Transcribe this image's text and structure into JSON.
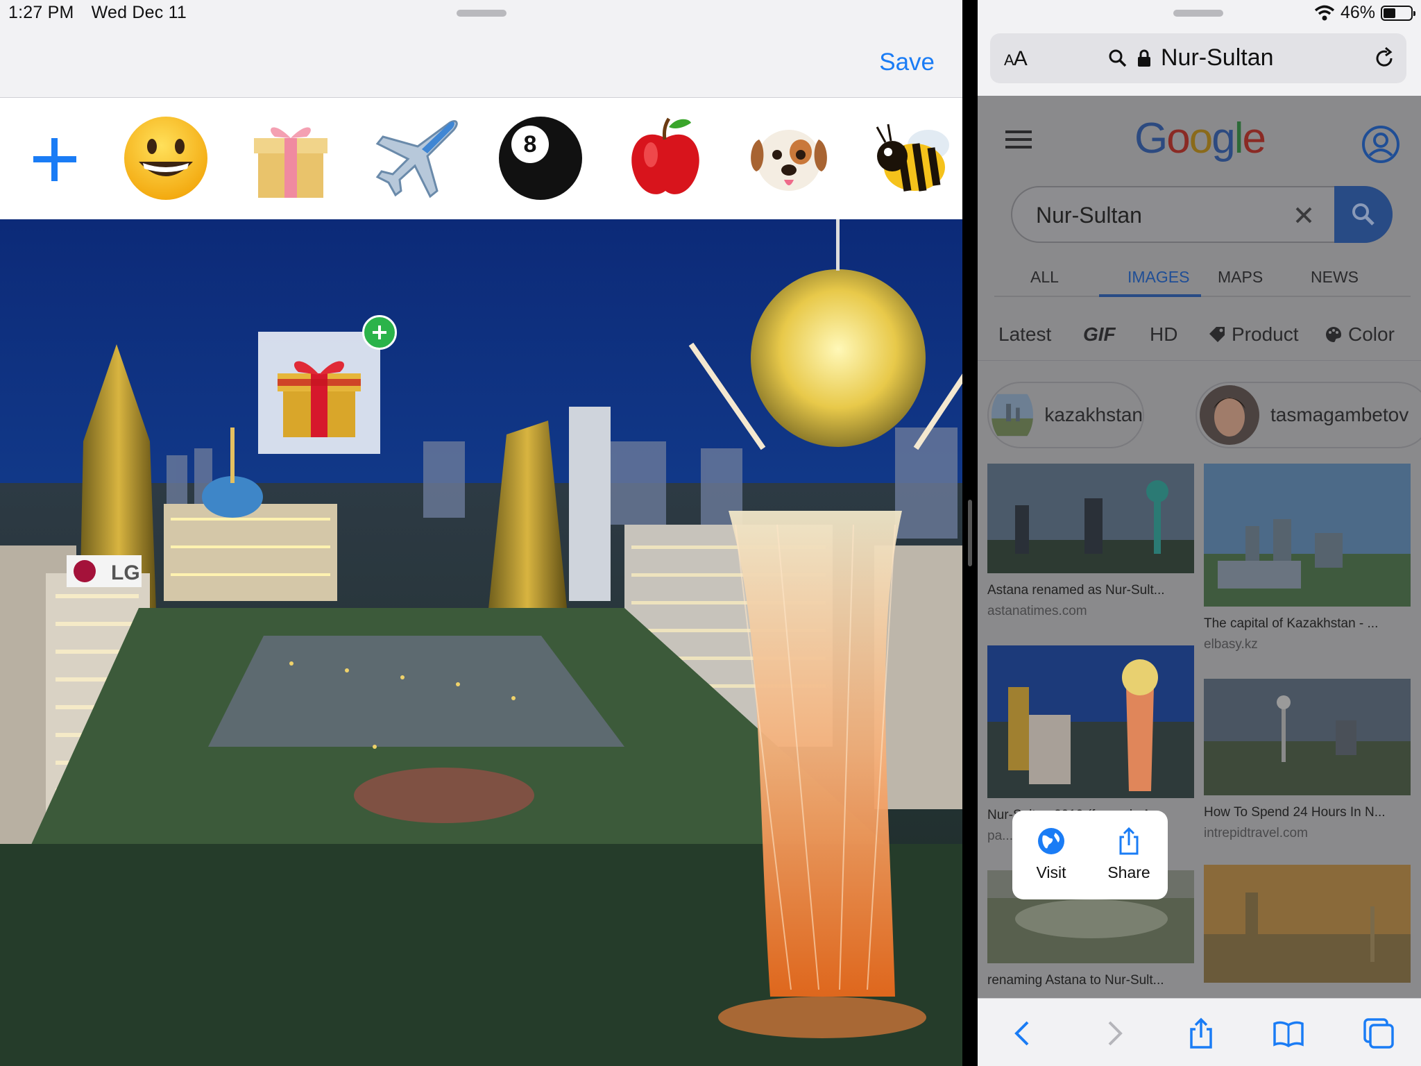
{
  "status_bar": {
    "time": "1:27 PM",
    "date": "Wed Dec 11",
    "battery_percent": "46%",
    "battery_level": 0.46
  },
  "left_app": {
    "save_label": "Save",
    "sticker_tray": {
      "add_icon": "plus-icon",
      "stickers": [
        "grinning-face-sticker",
        "gift-sticker",
        "airplane-sticker",
        "eight-ball-sticker",
        "red-apple-sticker",
        "dog-face-sticker",
        "honeybee-sticker"
      ]
    },
    "canvas": {
      "photo": "nur-sultan-skyline-photo",
      "placed_sticker": "gift-sticker",
      "placed_badge_icon": "plus-circle-icon"
    },
    "photo_signage": {
      "lg_sign": "LG"
    }
  },
  "safari": {
    "reader_label": "AA",
    "address": "Nur-Sultan",
    "google": {
      "logo": "Google",
      "search_value": "Nur-Sultan",
      "tabs": [
        "ALL",
        "IMAGES",
        "MAPS",
        "NEWS"
      ],
      "active_tab": "IMAGES",
      "filters": [
        "Latest",
        "GIF",
        "HD",
        "Product",
        "Color"
      ],
      "chips": [
        {
          "label": "kazakhstan"
        },
        {
          "label": "tasmagambetov"
        }
      ],
      "results_left": [
        {
          "caption": "Astana renamed as Nur-Sult...",
          "source": "astanatimes.com"
        },
        {
          "caption": "Nur-Sultan 2019 (formerly A...",
          "source": "pa..."
        },
        {
          "caption": "renaming Astana to Nur-Sult...",
          "source": ""
        }
      ],
      "results_right": [
        {
          "caption": "The capital of Kazakhstan - ...",
          "source": "elbasy.kz"
        },
        {
          "caption": "How To Spend 24 Hours In N...",
          "source": "intrepidtravel.com"
        },
        {
          "caption": "",
          "source": ""
        }
      ]
    },
    "context_menu": {
      "visit_label": "Visit",
      "share_label": "Share"
    },
    "toolbar": [
      "back-icon",
      "forward-icon",
      "share-icon",
      "bookmarks-icon",
      "tabs-icon"
    ]
  },
  "colors": {
    "accent_blue": "#1a7cf5",
    "badge_green": "#2bb34a",
    "google_blue_dim": "#284b85"
  }
}
